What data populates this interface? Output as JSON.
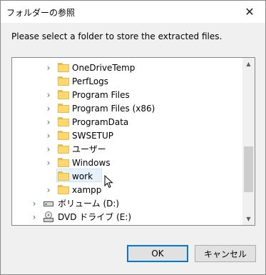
{
  "window": {
    "title": "フォルダーの参照",
    "close_glyph": "✕"
  },
  "instruction": "Please select a folder to store the extracted files.",
  "tree": {
    "items": [
      {
        "label": "OneDriveTemp",
        "type": "folder",
        "expandable": true
      },
      {
        "label": "PerfLogs",
        "type": "folder",
        "expandable": false
      },
      {
        "label": "Program Files",
        "type": "folder",
        "expandable": true
      },
      {
        "label": "Program Files (x86)",
        "type": "folder",
        "expandable": true
      },
      {
        "label": "ProgramData",
        "type": "folder",
        "expandable": true
      },
      {
        "label": "SWSETUP",
        "type": "folder",
        "expandable": true
      },
      {
        "label": "ユーザー",
        "type": "folder",
        "expandable": true
      },
      {
        "label": "Windows",
        "type": "folder",
        "expandable": true
      },
      {
        "label": "work",
        "type": "folder",
        "expandable": false,
        "selected": true
      },
      {
        "label": "xampp",
        "type": "folder",
        "expandable": true
      },
      {
        "label": "ボリューム (D:)",
        "type": "drive",
        "expandable": true
      },
      {
        "label": "DVD ドライブ (E:)",
        "type": "dvd",
        "expandable": true
      }
    ]
  },
  "buttons": {
    "ok": "OK",
    "cancel": "キャンセル"
  },
  "colors": {
    "selection": "#e5f1fb",
    "folder": "#ffd86e",
    "accent": "#0078d7"
  }
}
